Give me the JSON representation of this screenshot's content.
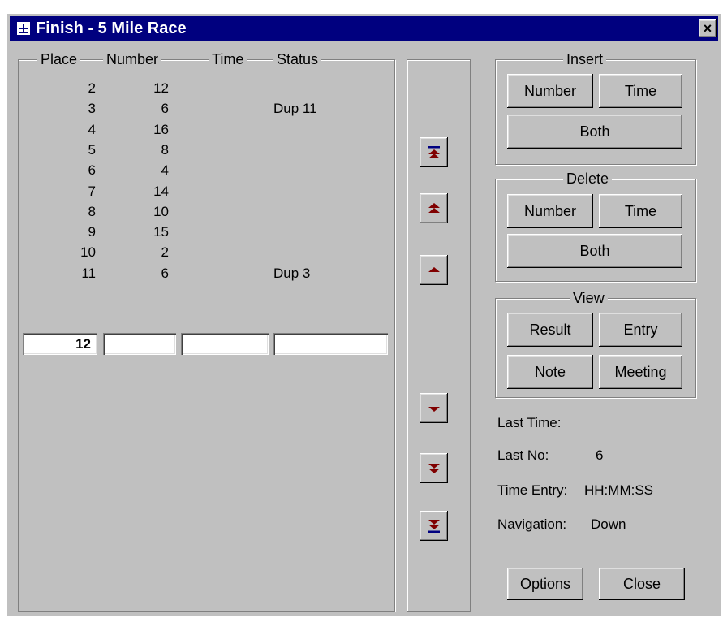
{
  "window": {
    "title": "Finish - 5 Mile Race",
    "close_symbol": "×",
    "icon": "form-icon"
  },
  "grid": {
    "headers": {
      "place": "Place",
      "number": "Number",
      "time": "Time",
      "status": "Status"
    },
    "rows": [
      {
        "place": "2",
        "number": "12",
        "time": "",
        "status": ""
      },
      {
        "place": "3",
        "number": "6",
        "time": "",
        "status": "Dup 11"
      },
      {
        "place": "4",
        "number": "16",
        "time": "",
        "status": ""
      },
      {
        "place": "5",
        "number": "8",
        "time": "",
        "status": ""
      },
      {
        "place": "6",
        "number": "4",
        "time": "",
        "status": ""
      },
      {
        "place": "7",
        "number": "14",
        "time": "",
        "status": ""
      },
      {
        "place": "8",
        "number": "10",
        "time": "",
        "status": ""
      },
      {
        "place": "9",
        "number": "15",
        "time": "",
        "status": ""
      },
      {
        "place": "10",
        "number": "2",
        "time": "",
        "status": ""
      },
      {
        "place": "11",
        "number": "6",
        "time": "",
        "status": "Dup 3"
      }
    ],
    "entry": {
      "place": "12",
      "number": "",
      "time": "",
      "status": ""
    }
  },
  "navigation_buttons": [
    {
      "name": "first",
      "icon": "double-up-bar-icon"
    },
    {
      "name": "page-up",
      "icon": "double-up-icon"
    },
    {
      "name": "up",
      "icon": "up-icon"
    },
    {
      "name": "down",
      "icon": "down-icon"
    },
    {
      "name": "page-down",
      "icon": "double-down-icon"
    },
    {
      "name": "last",
      "icon": "double-down-bar-icon"
    }
  ],
  "insert": {
    "title": "Insert",
    "number": "Number",
    "time": "Time",
    "both": "Both"
  },
  "delete": {
    "title": "Delete",
    "number": "Number",
    "time": "Time",
    "both": "Both"
  },
  "view": {
    "title": "View",
    "result": "Result",
    "entry": "Entry",
    "note": "Note",
    "meeting": "Meeting"
  },
  "info": {
    "last_time_label": "Last Time:",
    "last_time_value": "",
    "last_no_label": "Last No:",
    "last_no_value": "6",
    "time_entry_label": "Time Entry:",
    "time_entry_value": "HH:MM:SS",
    "navigation_label": "Navigation:",
    "navigation_value": "Down"
  },
  "footer": {
    "options": "Options",
    "close": "Close"
  },
  "colors": {
    "title_bar": "#00007f",
    "face": "#c0c0c0",
    "arrow": "#800000",
    "bar": "#000080"
  }
}
